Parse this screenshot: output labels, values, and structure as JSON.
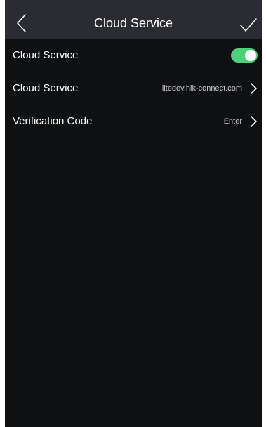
{
  "header": {
    "title": "Cloud Service",
    "back_icon": "chevron-left-icon",
    "confirm_icon": "checkmark-icon"
  },
  "settings": {
    "cloud_service_toggle": {
      "label": "Cloud Service",
      "enabled": true,
      "on_color": "#4cd07a"
    },
    "server_address": {
      "label": "Cloud Service",
      "value": "litedev.hik-connect.com"
    },
    "verification_code": {
      "label": "Verification Code",
      "value": "Enter"
    }
  },
  "colors": {
    "background": "#0f1012",
    "header_background": "#2b2c31",
    "divider": "#26272b"
  }
}
